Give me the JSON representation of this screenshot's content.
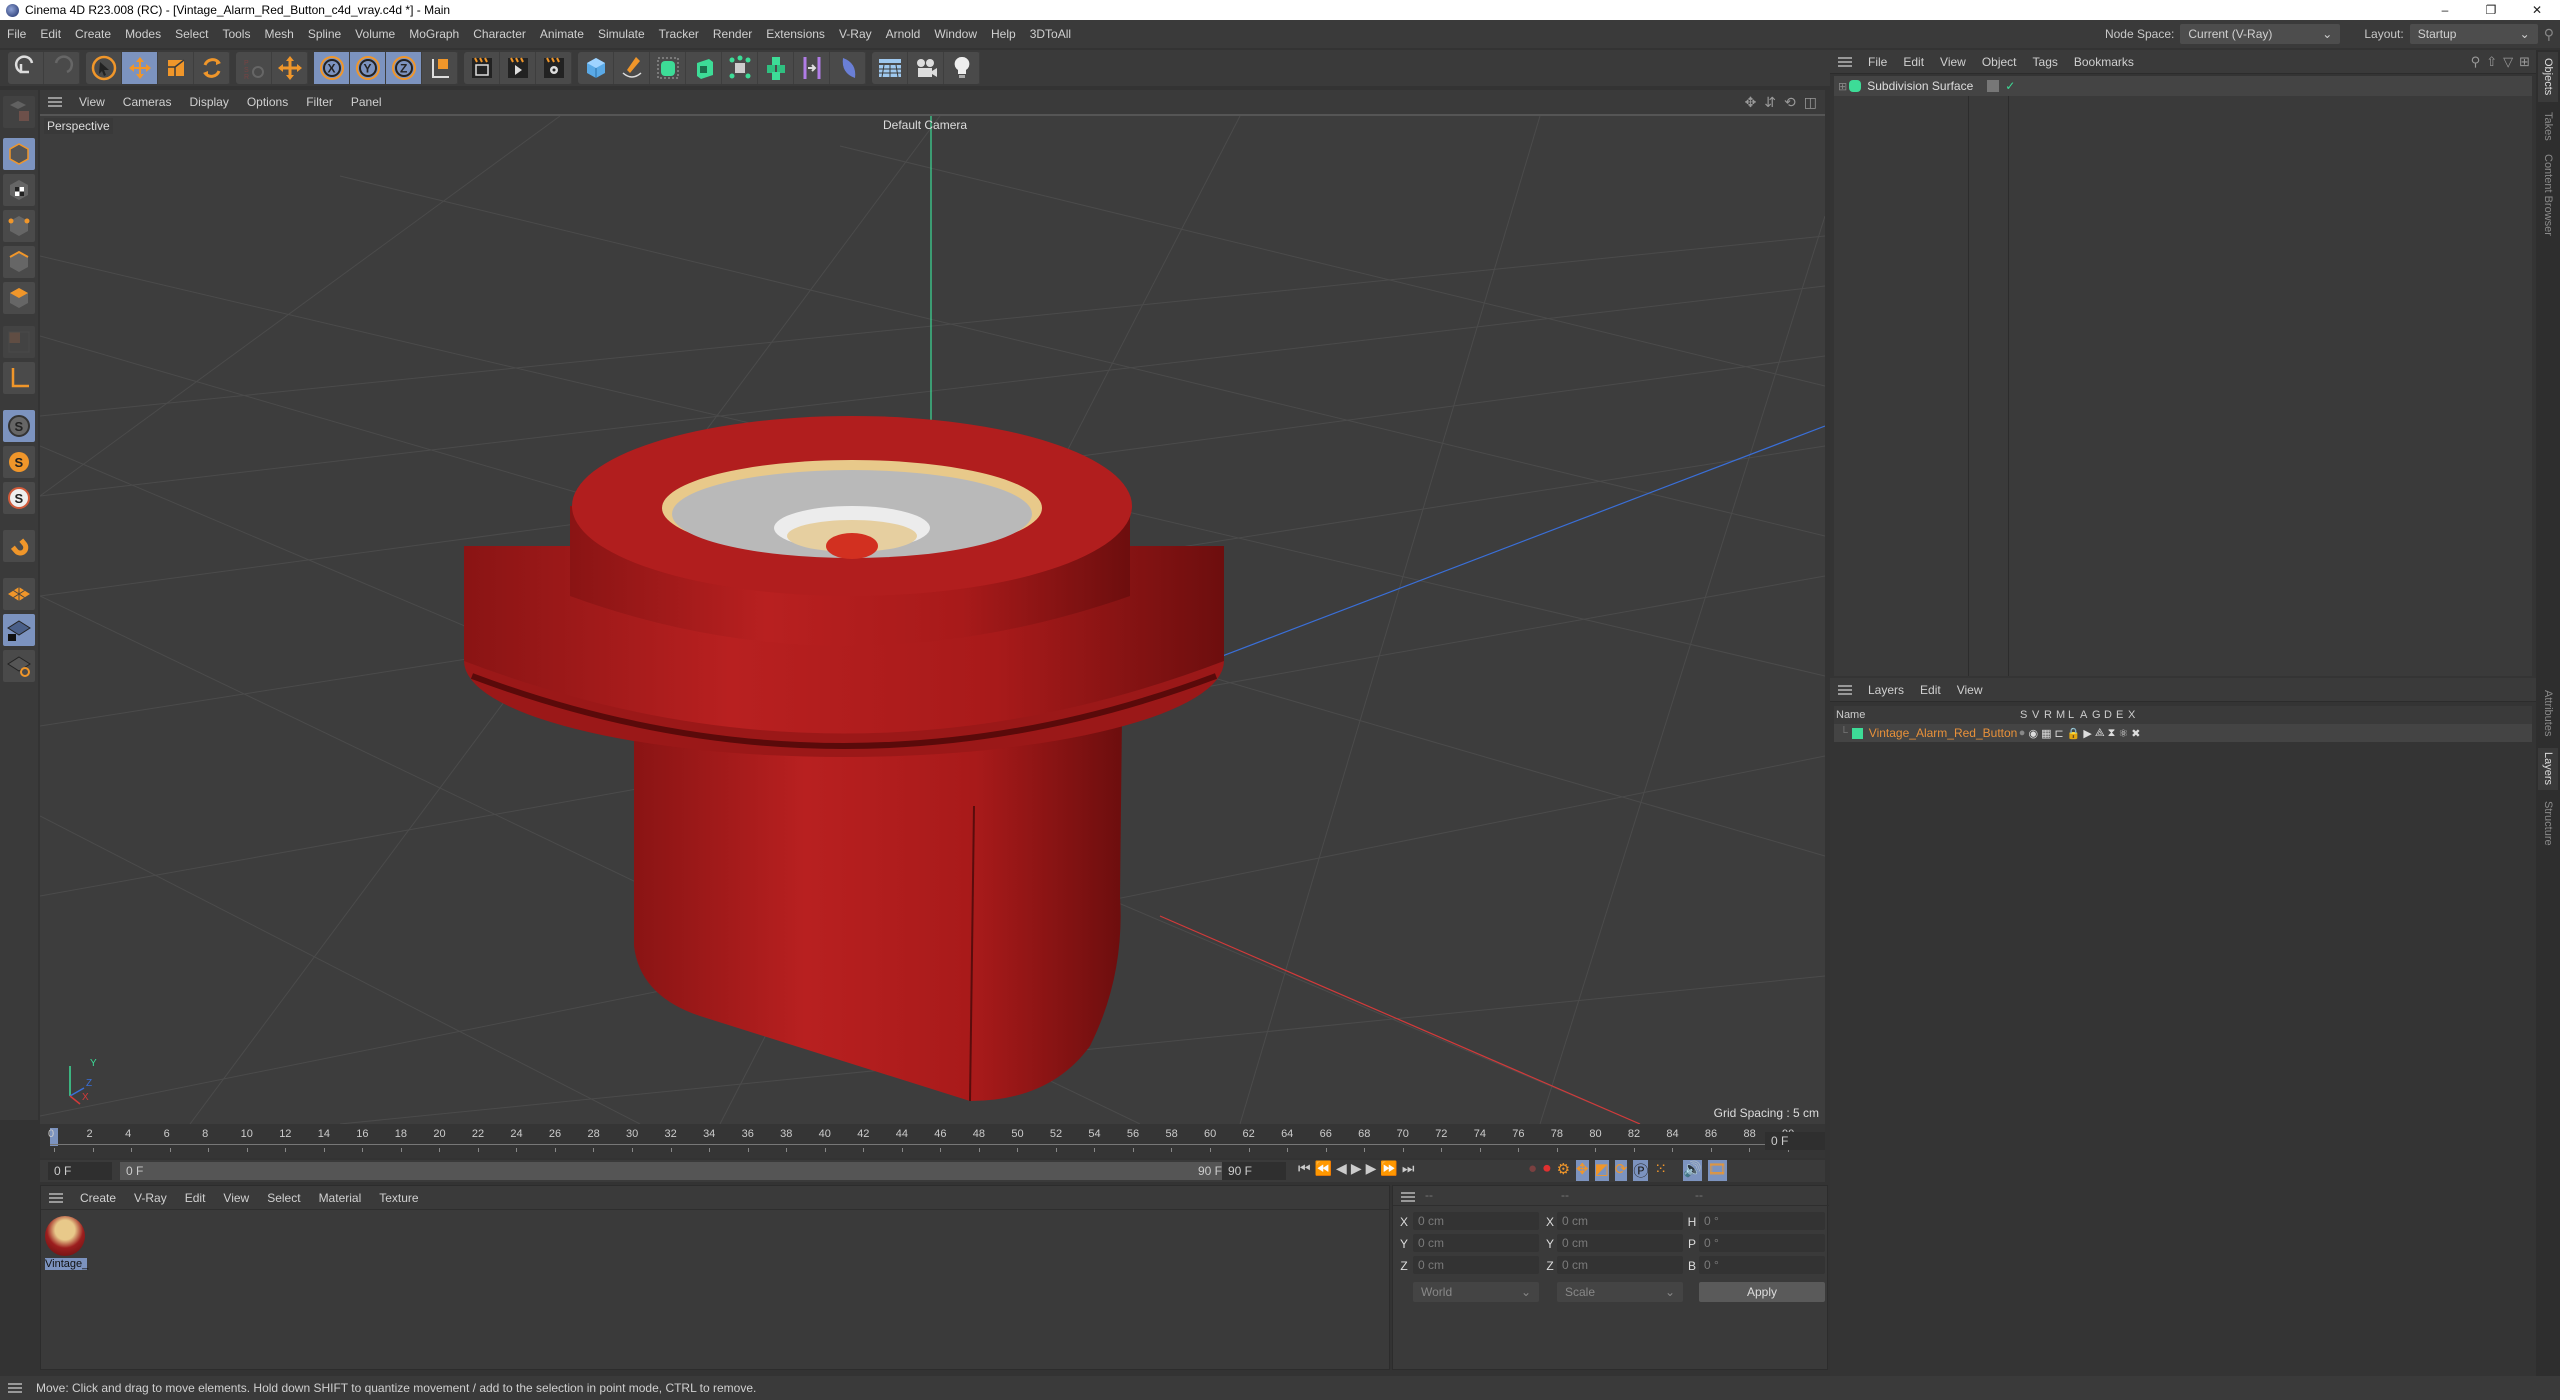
{
  "window": {
    "title": "Cinema 4D R23.008 (RC) - [Vintage_Alarm_Red_Button_c4d_vray.c4d *] - Main",
    "controls": [
      "–",
      "❐",
      "✕"
    ]
  },
  "menubar": {
    "items": [
      "File",
      "Edit",
      "Create",
      "Modes",
      "Select",
      "Tools",
      "Mesh",
      "Spline",
      "Volume",
      "MoGraph",
      "Character",
      "Animate",
      "Simulate",
      "Tracker",
      "Render",
      "Extensions",
      "V-Ray",
      "Arnold",
      "Window",
      "Help",
      "3DToAll"
    ],
    "node_space_label": "Node Space:",
    "node_space_value": "Current (V-Ray)",
    "layout_label": "Layout:",
    "layout_value": "Startup"
  },
  "toolbar": {
    "groups": [
      [
        "undo-icon",
        "redo-icon"
      ],
      [
        "select-arrow-icon",
        "move-icon",
        "scale-icon",
        "rotate-icon"
      ],
      [
        "psr-icon",
        "move-extra-icon"
      ],
      [
        "x-axis-icon",
        "y-axis-icon",
        "z-axis-icon",
        "coordinate-system-icon"
      ],
      [
        "render-region-icon",
        "render-view-icon",
        "render-settings-icon"
      ],
      [
        "cube-icon",
        "pen-icon",
        "subdivision-icon",
        "extrude-icon",
        "cloner-icon",
        "mograph-cubes-icon",
        "deformer-icon",
        "field-icon"
      ],
      [
        "floor-icon",
        "camera-icon",
        "light-icon"
      ]
    ]
  },
  "left_toolbar": {
    "items": [
      "make-editable-icon",
      "model-mode-icon",
      "texture-mode-icon",
      "point-mode-icon",
      "edge-mode-icon",
      "polygon-mode-icon",
      "uv-mode-icon",
      "axis-mode-icon",
      "snap-icon",
      "snap-settings-icon",
      "snap-enable-icon",
      "magnet-icon",
      "workplane-icon",
      "workplane-lock-icon",
      "workplane-align-icon"
    ]
  },
  "viewport": {
    "menu": [
      "View",
      "Cameras",
      "Display",
      "Options",
      "Filter",
      "Panel"
    ],
    "projection": "Perspective",
    "camera": "Default Camera",
    "grid_spacing": "Grid Spacing : 5 cm",
    "axis_labels": {
      "y": "Y",
      "z": "Z",
      "x": "X"
    },
    "nav_icons": [
      "pan-icon",
      "dolly-icon",
      "orbit-icon",
      "maximize-icon"
    ]
  },
  "timeline": {
    "ticks": [
      "0",
      "2",
      "4",
      "6",
      "8",
      "10",
      "12",
      "14",
      "16",
      "18",
      "20",
      "22",
      "24",
      "26",
      "28",
      "30",
      "32",
      "34",
      "36",
      "38",
      "40",
      "42",
      "44",
      "46",
      "48",
      "50",
      "52",
      "54",
      "56",
      "58",
      "60",
      "62",
      "64",
      "66",
      "68",
      "70",
      "72",
      "74",
      "76",
      "78",
      "80",
      "82",
      "84",
      "86",
      "88",
      "90"
    ],
    "current_frame": "0 F",
    "start_frame": "0 F",
    "range_start": "0 F",
    "range_end": "90 F",
    "end_frame": "90 F",
    "playback_icons": [
      "goto-start-icon",
      "prev-key-icon",
      "prev-frame-icon",
      "play-icon",
      "next-frame-icon",
      "next-key-icon",
      "goto-end-icon"
    ],
    "record_icons": [
      "record-icon",
      "autokey-icon",
      "keyframe-settings-icon",
      "key-move-icon",
      "key-scale-icon",
      "key-rotate-icon",
      "key-param-icon",
      "key-pla-icon",
      "sound-icon",
      "film-icon"
    ]
  },
  "material_manager": {
    "menu": [
      "Create",
      "V-Ray",
      "Edit",
      "View",
      "Select",
      "Material",
      "Texture"
    ],
    "materials": [
      {
        "name": "Vintage_"
      }
    ]
  },
  "coordinates": {
    "headers": [
      "--",
      "--",
      "--"
    ],
    "rows": [
      {
        "pos_label": "X",
        "pos": "0 cm",
        "size_label": "X",
        "size": "0 cm",
        "rot_label": "H",
        "rot": "0 °"
      },
      {
        "pos_label": "Y",
        "pos": "0 cm",
        "size_label": "Y",
        "size": "0 cm",
        "rot_label": "P",
        "rot": "0 °"
      },
      {
        "pos_label": "Z",
        "pos": "0 cm",
        "size_label": "Z",
        "size": "0 cm",
        "rot_label": "B",
        "rot": "0 °"
      }
    ],
    "space": "World",
    "mode": "Scale",
    "apply": "Apply"
  },
  "objects_panel": {
    "menu": [
      "File",
      "Edit",
      "View",
      "Object",
      "Tags",
      "Bookmarks"
    ],
    "items": [
      {
        "name": "Subdivision Surface"
      }
    ]
  },
  "layers_panel": {
    "menu": [
      "Layers",
      "Edit",
      "View"
    ],
    "columns": [
      "Name",
      "S",
      "V",
      "R",
      "M",
      "L",
      "A",
      "G",
      "D",
      "E",
      "X"
    ],
    "layers": [
      {
        "name": "Vintage_Alarm_Red_Button",
        "color": "#3ddc97"
      }
    ]
  },
  "side_tabs": {
    "top": [
      "Objects",
      "Takes",
      "Content Browser"
    ],
    "bottom": [
      "Attributes",
      "Layers",
      "Structure"
    ]
  },
  "status": {
    "text": "Move: Click and drag to move elements. Hold down SHIFT to quantize movement / add to the selection in point mode, CTRL to remove."
  },
  "colors": {
    "accent_orange": "#f0962a",
    "active_blue": "#7c93bf",
    "layer_name": "#e8913a"
  }
}
